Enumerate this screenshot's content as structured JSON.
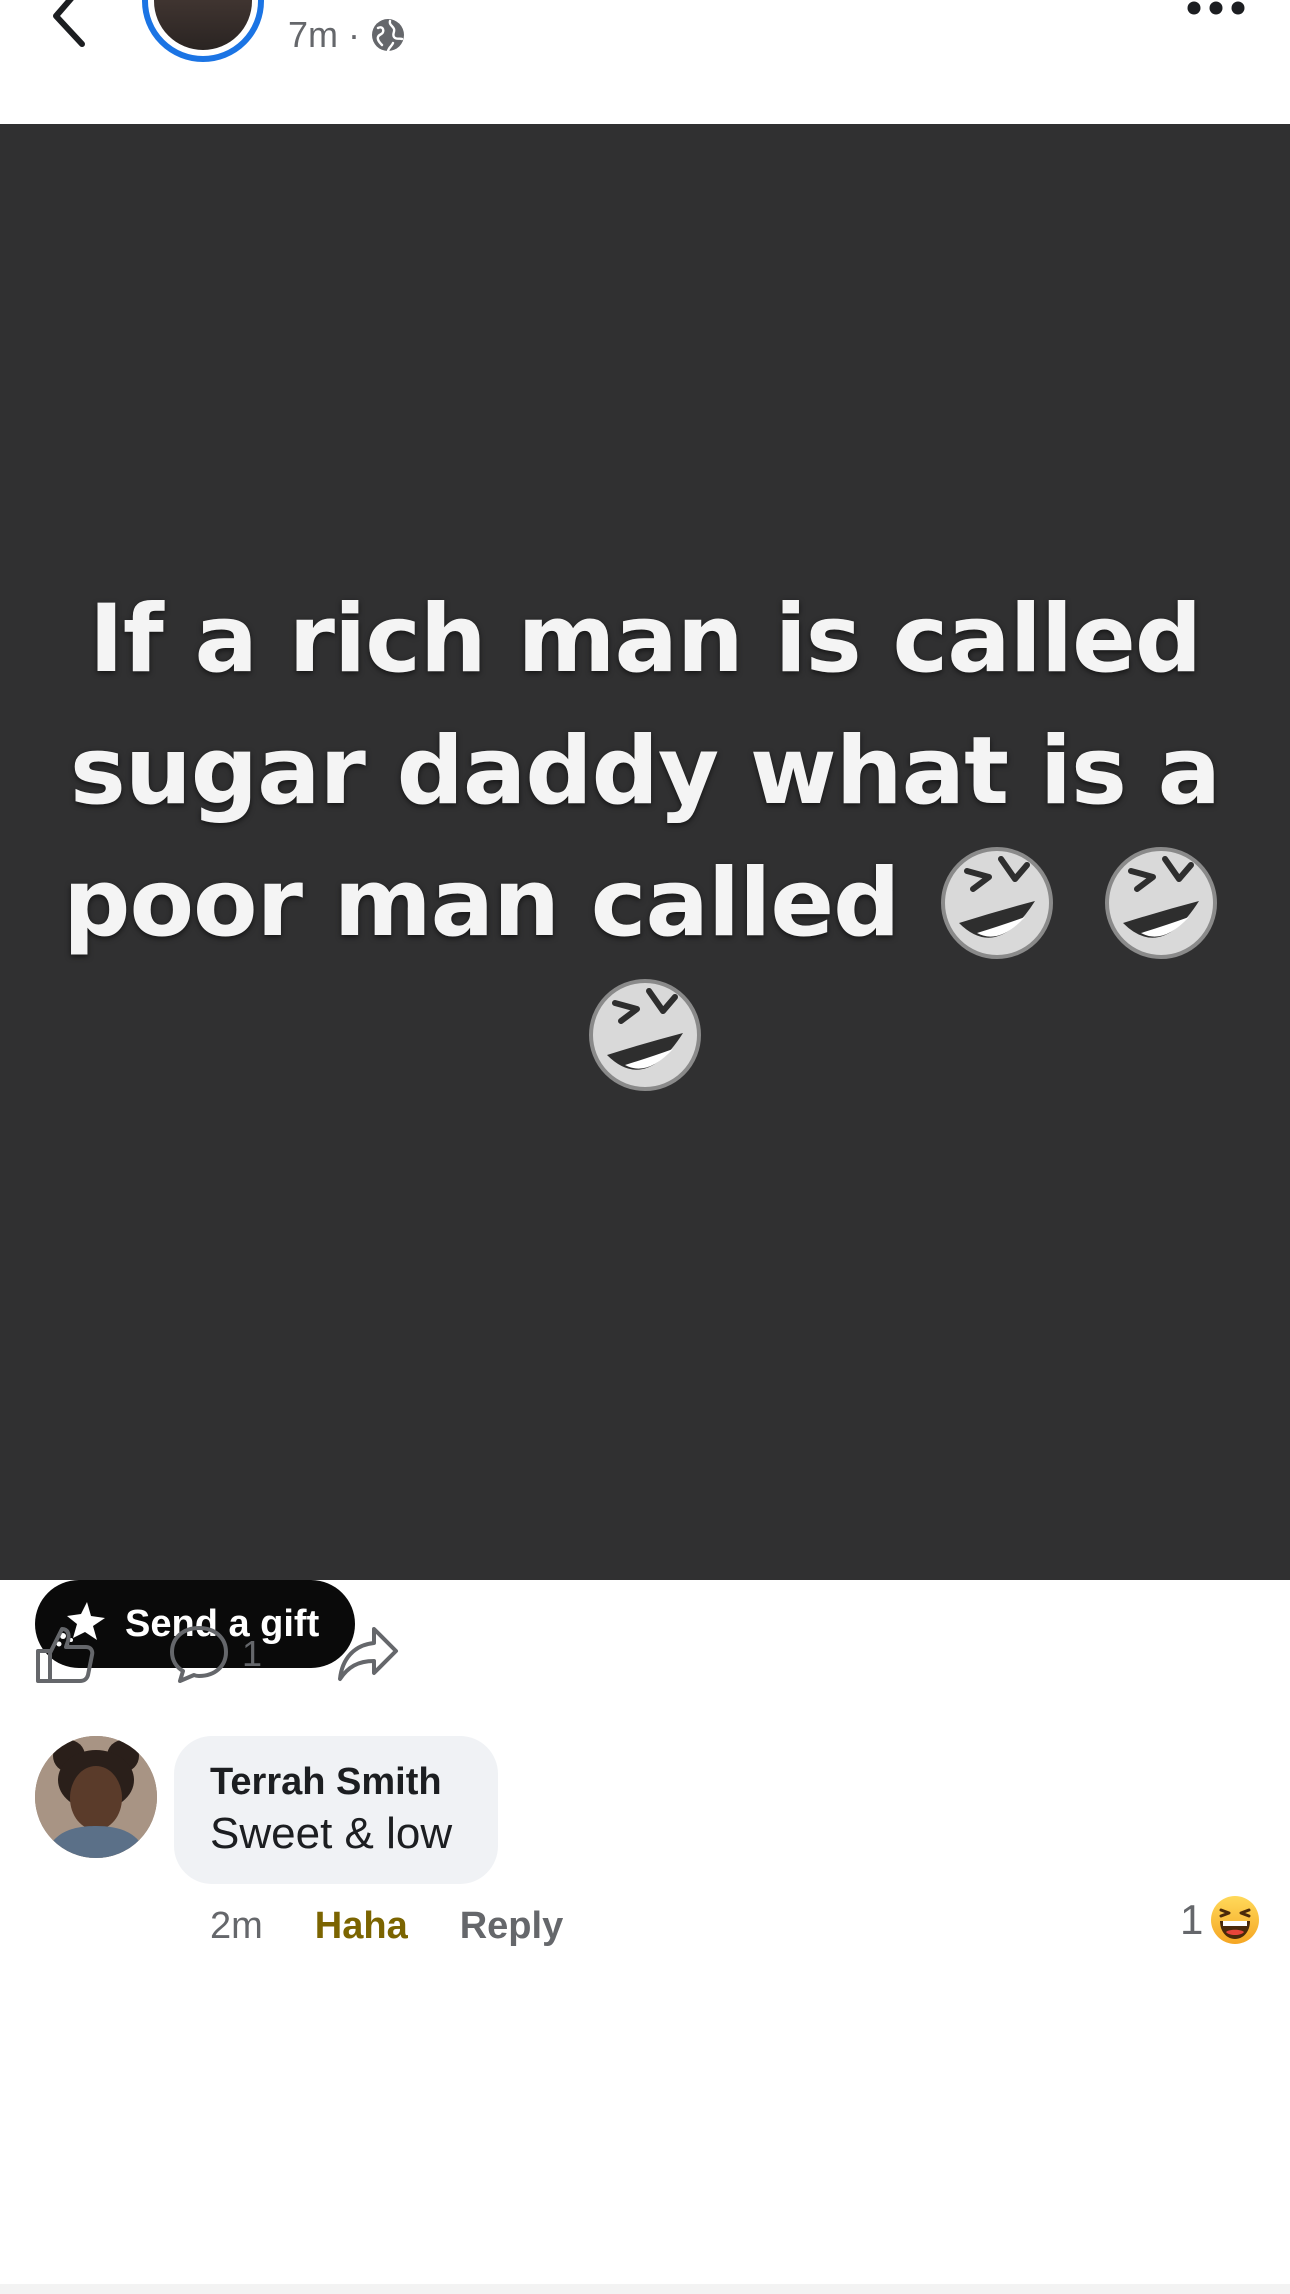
{
  "header": {
    "timestamp": "7m",
    "separator": "·",
    "icons": {
      "back": "chevron-left-icon",
      "audience": "globe-icon",
      "more": "more-horizontal-icon"
    },
    "avatar_ring_color": "#1b74e4"
  },
  "post": {
    "background_color": "#303031",
    "text_line_1": "If a rich man is called",
    "text_line_2": "sugar daddy what is a",
    "text_line_3": "poor man called",
    "emoji": "rolling-on-floor-laughing",
    "gift_button_label": "Send a gift"
  },
  "actions": {
    "comment_count": "1",
    "icons": [
      "like-icon",
      "comment-icon",
      "share-icon"
    ]
  },
  "comment": {
    "author": "Terrah Smith",
    "text": "Sweet & low",
    "time": "2m",
    "reaction_label": "Haha",
    "reply_label": "Reply",
    "reaction_count": "1",
    "reaction_color": "#7b6400"
  }
}
